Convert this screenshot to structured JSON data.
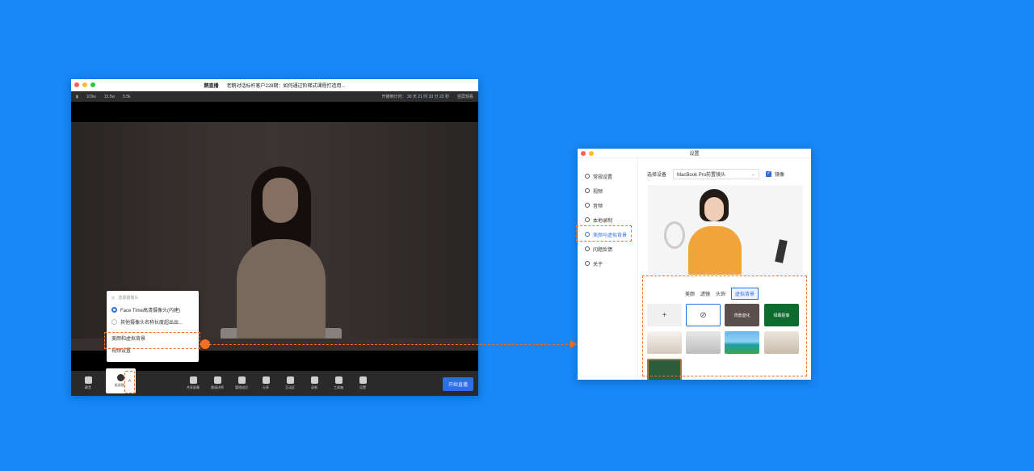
{
  "live_window": {
    "app_name": "鹅直播",
    "session_title": "老鹅对话标杆客户228期：如何通过阶梯式课程打造用...",
    "stats": {
      "a": "109w",
      "b": "15.5w",
      "c": "5.5k"
    },
    "countdown_label": "开播倒计时：",
    "countdown": [
      "30",
      "天",
      "21",
      "时",
      "33",
      "分",
      "22",
      "秒"
    ],
    "layout_label": "竖屏观看",
    "toolbar": {
      "mic_label": "静音",
      "camera_label": "关闭视频",
      "tools": [
        "共享屏幕",
        "邀请讲师",
        "管理成员",
        "分享",
        "互动区",
        "录制",
        "工具箱",
        "设置"
      ],
      "start_button": "开始直播"
    },
    "camera_menu": {
      "header": "选择摄像头",
      "options": [
        "Face Time高清摄像头(内建)",
        "其他摄像头名称长度超出出..."
      ],
      "items": [
        "美颜和虚拟背景",
        "视频设置"
      ]
    }
  },
  "settings_window": {
    "title": "设置",
    "sidebar": [
      "常规设置",
      "视频",
      "音频",
      "本地录制",
      "美颜与虚拟背景",
      "问题反馈",
      "关于"
    ],
    "device_label": "选择设备",
    "device_value": "MacBook Pro前置镜头",
    "mirror_label": "镜像",
    "bg_tabs": [
      "美颜",
      "滤镜",
      "头饰",
      "虚拟背景"
    ],
    "thumbs": [
      "+",
      "⊘",
      "背景虚化",
      "绿幕抠像"
    ]
  },
  "colors": {
    "background": "#1887f7",
    "accent": "#2f6fe5",
    "highlight": "#f36f21"
  }
}
